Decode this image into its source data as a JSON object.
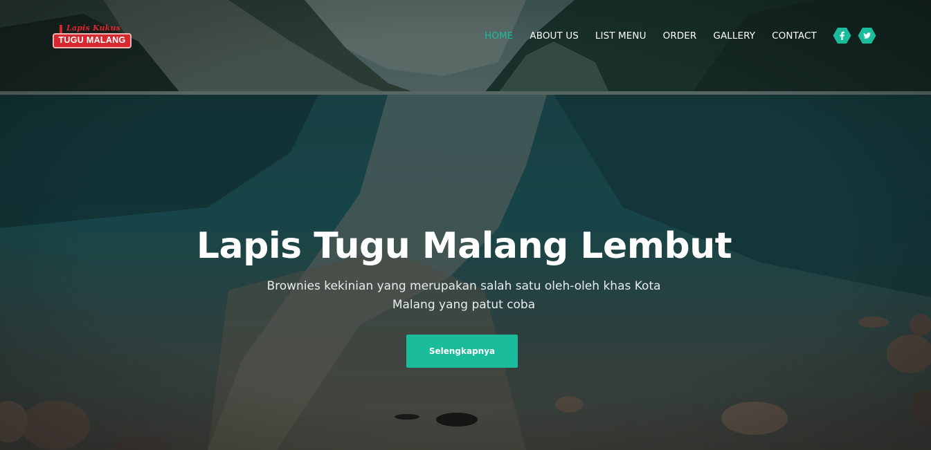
{
  "brand": {
    "logo_script": "Lapis Kukus",
    "logo_name": "TUGU MALANG",
    "accent": "#1abc9c",
    "logo_red": "#d8282f"
  },
  "nav": {
    "items": [
      {
        "label": "HOME",
        "active": true
      },
      {
        "label": "ABOUT US",
        "active": false
      },
      {
        "label": "LIST MENU",
        "active": false
      },
      {
        "label": "ORDER",
        "active": false
      },
      {
        "label": "GALLERY",
        "active": false
      },
      {
        "label": "CONTACT",
        "active": false
      }
    ]
  },
  "social": {
    "icons": [
      "facebook-icon",
      "twitter-icon"
    ]
  },
  "hero": {
    "title": "Lapis Tugu Malang Lembut",
    "subtitle_line1": "Brownies kekinian yang merupakan salah satu oleh-oleh khas Kota",
    "subtitle_line2": "Malang yang patut coba",
    "cta_label": "Selengkapnya",
    "background": "mountain-lake-landscape"
  }
}
